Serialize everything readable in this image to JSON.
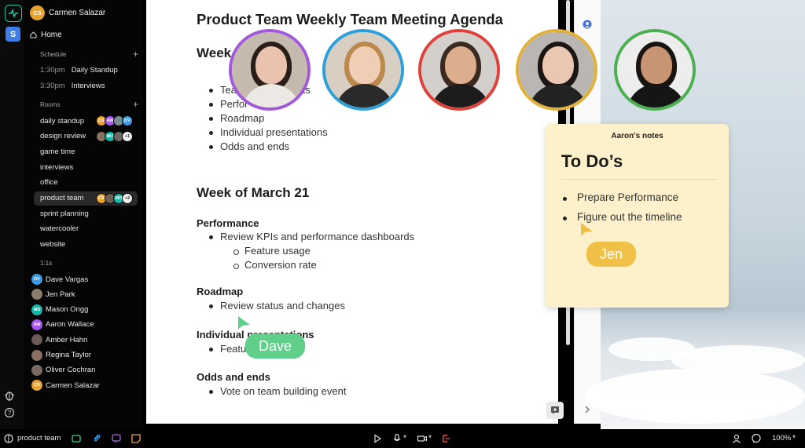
{
  "sidebar": {
    "workspace_initial": "S",
    "user": {
      "initials": "CS",
      "name": "Carmen Salazar",
      "color": "#e8a230"
    },
    "home_label": "Home",
    "schedule_label": "Schedule",
    "schedule": [
      {
        "time": "1:30pm",
        "title": "Daily Standup"
      },
      {
        "time": "3:30pm",
        "title": "Interviews"
      }
    ],
    "rooms_label": "Rooms",
    "rooms": [
      {
        "name": "daily standup",
        "avatars": [
          {
            "initials": "CS",
            "color": "#e8a230"
          },
          {
            "initials": "AW",
            "color": "#a855f7"
          },
          {
            "initials": "",
            "color": "#7a8b8e"
          },
          {
            "initials": "DV",
            "color": "#3b9be8"
          }
        ]
      },
      {
        "name": "design review",
        "avatars": [
          {
            "initials": "",
            "color": "#8a6f63"
          },
          {
            "initials": "MO",
            "color": "#14b8a6"
          },
          {
            "initials": "",
            "color": "#6d6560"
          },
          {
            "initials": "+1",
            "color": "#f2f2f2"
          }
        ]
      },
      {
        "name": "game time",
        "avatars": []
      },
      {
        "name": "interviews",
        "avatars": []
      },
      {
        "name": "office",
        "avatars": []
      },
      {
        "name": "product team",
        "active": true,
        "avatars": [
          {
            "initials": "CS",
            "color": "#e8a230"
          },
          {
            "initials": "",
            "color": "#6d5e56"
          },
          {
            "initials": "MO",
            "color": "#14b8a6"
          },
          {
            "initials": "+2",
            "color": "#f2f2f2"
          }
        ]
      },
      {
        "name": "sprint planning",
        "avatars": []
      },
      {
        "name": "watercooler",
        "avatars": []
      },
      {
        "name": "website",
        "avatars": []
      }
    ],
    "dms_label": "1:1s",
    "dms": [
      {
        "initials": "DV",
        "name": "Dave Vargas",
        "color": "#3b9be8"
      },
      {
        "initials": "",
        "name": "Jen Park",
        "color": "#8a7b6a"
      },
      {
        "initials": "MO",
        "name": "Mason Ongg",
        "color": "#14b8a6"
      },
      {
        "initials": "AW",
        "name": "Aaron Wallace",
        "color": "#a855f7"
      },
      {
        "initials": "",
        "name": "Amber Hahn",
        "color": "#6b5a55"
      },
      {
        "initials": "",
        "name": "Regina Taylor",
        "color": "#8a6f63"
      },
      {
        "initials": "",
        "name": "Oliver Cochran",
        "color": "#7a6a60"
      },
      {
        "initials": "CS",
        "name": "Carmen Salazar",
        "color": "#e8a230"
      }
    ]
  },
  "document": {
    "title": "Product Team Weekly Team Meeting Agenda",
    "week1_heading": "Week",
    "week1_items": [
      "Team",
      "Perfor",
      "Roadmap",
      "Individual presentations",
      "Odds and ends"
    ],
    "week1_partial_text": "ents",
    "week2_heading": "Week of March 21",
    "sections": {
      "performance": {
        "heading": "Performance",
        "item": "Review KPIs and performance dashboards",
        "sub": [
          "Feature usage",
          "Conversion rate"
        ]
      },
      "roadmap": {
        "heading": "Roadmap",
        "item": "Review status and changes"
      },
      "individual": {
        "heading": "Individual presentations",
        "item": "Featu"
      },
      "odds": {
        "heading": "Odds and ends",
        "item": "Vote on team building event"
      }
    }
  },
  "participants": [
    {
      "name": "participant-1",
      "ring": "#a259d9",
      "skin": "#e9c3ad",
      "hair": "#2b1d18",
      "shirt": "#ece8e4",
      "bg": "#c6b9ad"
    },
    {
      "name": "participant-2",
      "ring": "#2d9fd9",
      "skin": "#f0cdb5",
      "hair": "#b9894d",
      "shirt": "#2a2a2a",
      "bg": "#d8cfc2"
    },
    {
      "name": "participant-3",
      "ring": "#e0413b",
      "skin": "#dcae8e",
      "hair": "#3a2a20",
      "shirt": "#1c1c1c",
      "bg": "#d3d0cc"
    },
    {
      "name": "participant-4",
      "ring": "#e2b13c",
      "skin": "#eac7b0",
      "hair": "#1b1514",
      "shirt": "#222222",
      "bg": "#b9b6b3"
    },
    {
      "name": "participant-5",
      "ring": "#4caf50",
      "skin": "#c89572",
      "hair": "#1a1411",
      "shirt": "#151515",
      "bg": "#ededed"
    }
  ],
  "note": {
    "header": "Aaron's notes",
    "title": "To Do’s",
    "items": [
      "Prepare Performance",
      "Figure out the timeline"
    ]
  },
  "cursors": {
    "jen": {
      "label": "Jen",
      "color": "#f0c146"
    },
    "dave": {
      "label": "Dave",
      "color": "#5fcf8a"
    }
  },
  "bottombar": {
    "room_name": "product team",
    "zoom": "100%",
    "icons": [
      "room-icon",
      "screen-share-icon",
      "paperclip-icon",
      "chat-bubble-icon",
      "sticky-note-icon",
      "play-icon",
      "microphone-icon",
      "camera-icon",
      "leave-icon",
      "person-icon",
      "comment-icon",
      "chevron-down-icon"
    ]
  },
  "colors": {
    "accent": "#2ec4a1",
    "workspace": "#3f7de8"
  }
}
